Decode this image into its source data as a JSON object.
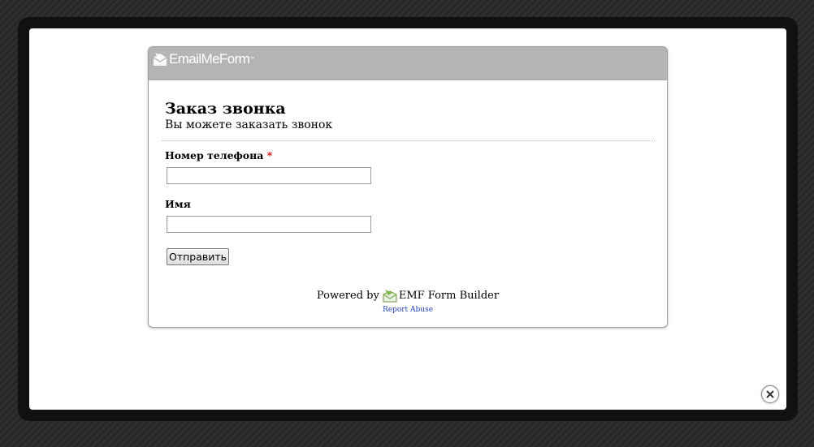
{
  "header": {
    "logo_text": "EmailMeForm",
    "logo_tm": "™"
  },
  "form": {
    "title": "Заказ звонка",
    "description": "Вы можете заказать звонок",
    "fields": [
      {
        "label": "Номер телефона",
        "required_mark": "*",
        "value": "",
        "placeholder": ""
      },
      {
        "label": "Имя",
        "value": "",
        "placeholder": ""
      }
    ],
    "submit_label": "Отправить"
  },
  "footer": {
    "powered_prefix": "Powered by",
    "builder_name": "EMF Form Builder",
    "report_abuse": "Report Abuse"
  },
  "lightbox": {
    "close_icon": "close-icon"
  },
  "colors": {
    "header_bg": "#b4b4b4",
    "required": "#d40000",
    "link": "#2040b0",
    "backdrop": "#2b2b2b"
  }
}
